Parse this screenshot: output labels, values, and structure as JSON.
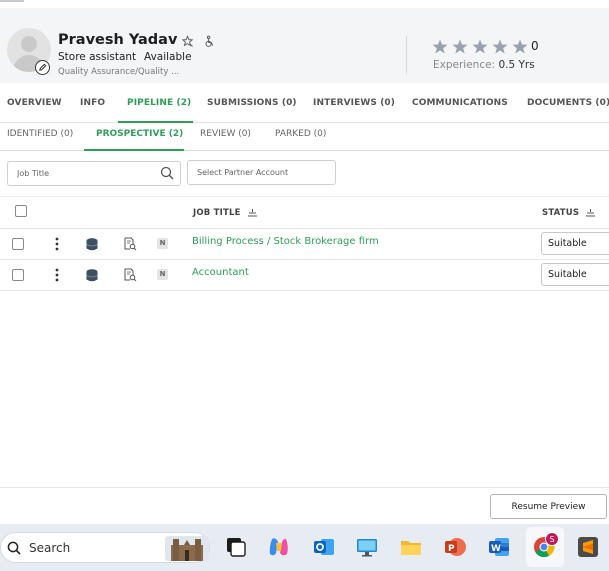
{
  "profile": {
    "name": "Pravesh Yadav",
    "role": "Store assistant",
    "availability": "Available",
    "department": "Quality Assurance/Quality ...",
    "rating_count": "0",
    "rating_stars": 0,
    "experience_label": "Experience:",
    "experience_value": "0.5 Yrs"
  },
  "main_tabs": [
    {
      "label": "OVERVIEW"
    },
    {
      "label": "INFO"
    },
    {
      "label": "PIPELINE (2)"
    },
    {
      "label": "SUBMISSIONS (0)"
    },
    {
      "label": "INTERVIEWS (0)"
    },
    {
      "label": "COMMUNICATIONS"
    },
    {
      "label": "DOCUMENTS (0)"
    }
  ],
  "active_main_tab": "PIPELINE (2)",
  "sub_tabs": [
    {
      "label": "IDENTIFIED (0)"
    },
    {
      "label": "PROSPECTIVE (2)"
    },
    {
      "label": "REVIEW (0)"
    },
    {
      "label": "PARKED (0)"
    }
  ],
  "active_sub_tab": "PROSPECTIVE (2)",
  "filters": {
    "job_title_placeholder": "Job Title",
    "partner_account_placeholder": "Select Partner Account"
  },
  "table": {
    "columns": {
      "job_title": "JOB TITLE",
      "status": "STATUS"
    },
    "rows": [
      {
        "job_title": "Billing Process / Stock Brokerage firm",
        "badge": "N",
        "status": "Suitable"
      },
      {
        "job_title": "Accountant",
        "badge": "N",
        "status": "Suitable"
      }
    ]
  },
  "footer": {
    "resume_preview_label": "Resume Preview"
  },
  "taskbar": {
    "search_label": "Search",
    "chrome_badge": "S",
    "apps": [
      "task-view-icon",
      "copilot-icon",
      "outlook-icon",
      "computer-icon",
      "file-explorer-icon",
      "powerpoint-icon",
      "word-icon",
      "chrome-icon",
      "sublime-text-icon"
    ]
  },
  "colors": {
    "accent": "#2e9e59",
    "header_bg": "#f4f5f7",
    "taskbar_bg": "#e7ecf2",
    "star": "#9aa3ad"
  }
}
